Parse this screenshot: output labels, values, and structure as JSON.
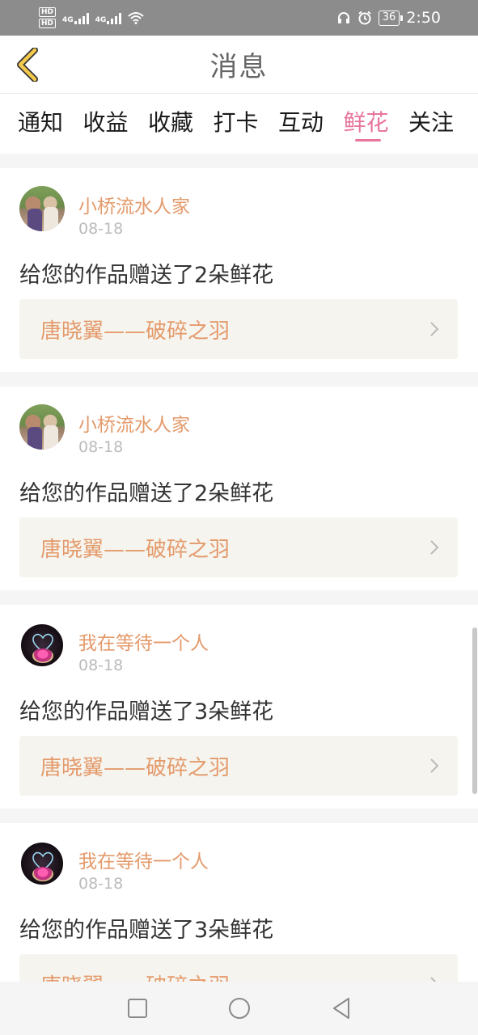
{
  "status_bar": {
    "hd_top": "HD",
    "hd_bottom": "HD",
    "net1": "4G",
    "net2": "4G",
    "battery": "36",
    "time": "2:50"
  },
  "header": {
    "title": "消息"
  },
  "tabs": [
    {
      "label": "通知",
      "active": false
    },
    {
      "label": "收益",
      "active": false
    },
    {
      "label": "收藏",
      "active": false
    },
    {
      "label": "打卡",
      "active": false
    },
    {
      "label": "互动",
      "active": false
    },
    {
      "label": "鲜花",
      "active": true
    },
    {
      "label": "关注",
      "active": false
    }
  ],
  "feed": [
    {
      "user": "小桥流水人家",
      "date": "08-18",
      "message": "给您的作品赠送了2朵鲜花",
      "work": "唐晓翼——破碎之羽"
    },
    {
      "user": "小桥流水人家",
      "date": "08-18",
      "message": "给您的作品赠送了2朵鲜花",
      "work": "唐晓翼——破碎之羽"
    },
    {
      "user": "我在等待一个人",
      "date": "08-18",
      "message": "给您的作品赠送了3朵鲜花",
      "work": "唐晓翼——破碎之羽"
    },
    {
      "user": "我在等待一个人",
      "date": "08-18",
      "message": "给您的作品赠送了3朵鲜花",
      "work": "唐晓翼——破碎之羽"
    }
  ],
  "colors": {
    "accent_pink": "#e8759a",
    "username_orange": "#e49a6b",
    "back_icon_yellow": "#f2c94c",
    "status_bar_gray": "#8c8c8c"
  },
  "icons": {
    "back": "chevron-left-icon",
    "card_arrow": "chevron-right-icon",
    "nav": [
      "square-recents-icon",
      "circle-home-icon",
      "triangle-back-icon"
    ]
  }
}
